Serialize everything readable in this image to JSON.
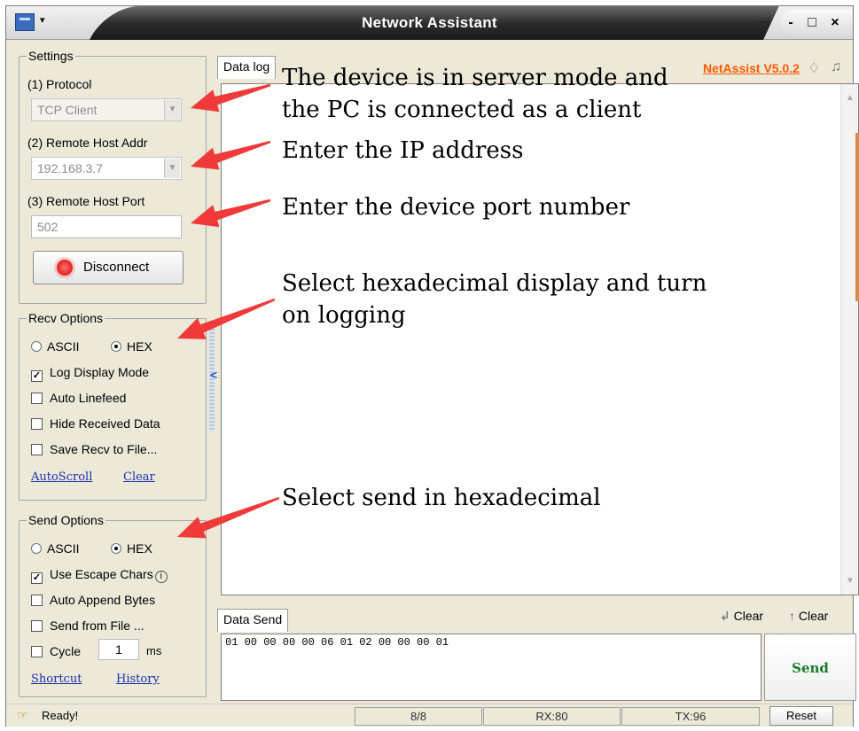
{
  "window": {
    "title": "Network Assistant",
    "controls": "- □ ×",
    "pin_glyph": "⊣"
  },
  "settings": {
    "legend": "Settings",
    "protocol_label": "(1) Protocol",
    "protocol_value": "TCP Client",
    "host_label": "(2) Remote Host Addr",
    "host_value": "192.168.3.7",
    "port_label": "(3) Remote Host Port",
    "port_value": "502",
    "connect_button": "Disconnect"
  },
  "recv_options": {
    "legend": "Recv Options",
    "ascii": "ASCII",
    "hex": "HEX",
    "log_display_mode": "Log Display Mode",
    "auto_linefeed": "Auto Linefeed",
    "hide_received": "Hide Received Data",
    "save_recv": "Save Recv to File...",
    "autoscroll": "AutoScroll",
    "clear": "Clear"
  },
  "send_options": {
    "legend": "Send Options",
    "ascii": "ASCII",
    "hex": "HEX",
    "use_escape": "Use Escape Chars",
    "auto_append": "Auto Append Bytes",
    "send_from_file": "Send from File ...",
    "cycle": "Cycle",
    "cycle_value": "1",
    "cycle_unit": "ms",
    "shortcut": "Shortcut",
    "history": "History"
  },
  "data_log": {
    "tab": "Data log",
    "version": "NetAssist V5.0.2"
  },
  "data_send": {
    "tab": "Data Send",
    "clear1": "Clear",
    "clear2": "Clear",
    "content": "01 00 00 00 00 06 01 02 00 00 00 01",
    "send_button": "Send"
  },
  "status": {
    "ready": "Ready!",
    "count": "8/8",
    "rx": "RX:80",
    "tx": "TX:96",
    "reset": "Reset"
  },
  "annotations": {
    "a1": "The device is in server mode and\nthe PC is connected as a client",
    "a2": "Enter the IP address",
    "a3": "Enter the device port number",
    "a4": "Select hexadecimal display and turn\non logging",
    "a5": "Select send in hexadecimal"
  },
  "colors": {
    "arrow": "#f03a3a",
    "version": "#ff5a00",
    "send_text": "#1a7a2a",
    "link": "#1a2fb0"
  }
}
